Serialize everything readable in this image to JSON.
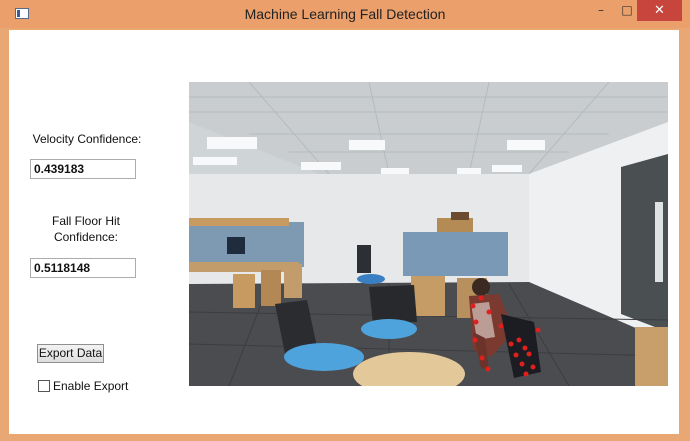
{
  "window": {
    "title": "Machine Learning Fall Detection",
    "buttons": {
      "minimize": "–",
      "maximize": "□",
      "close": "✕"
    }
  },
  "velocity": {
    "label": "Velocity Confidence:",
    "value": "0.439183"
  },
  "fall_floor": {
    "label_line1": "Fall Floor Hit",
    "label_line2": "Confidence:",
    "value": "0.5118148"
  },
  "export": {
    "button_label": "Export Data",
    "checkbox_label": "Enable Export",
    "checked": false
  },
  "camera_feed": {
    "icon": "camera-frame",
    "colors": {
      "skeleton_joints": "#e0201c"
    }
  }
}
